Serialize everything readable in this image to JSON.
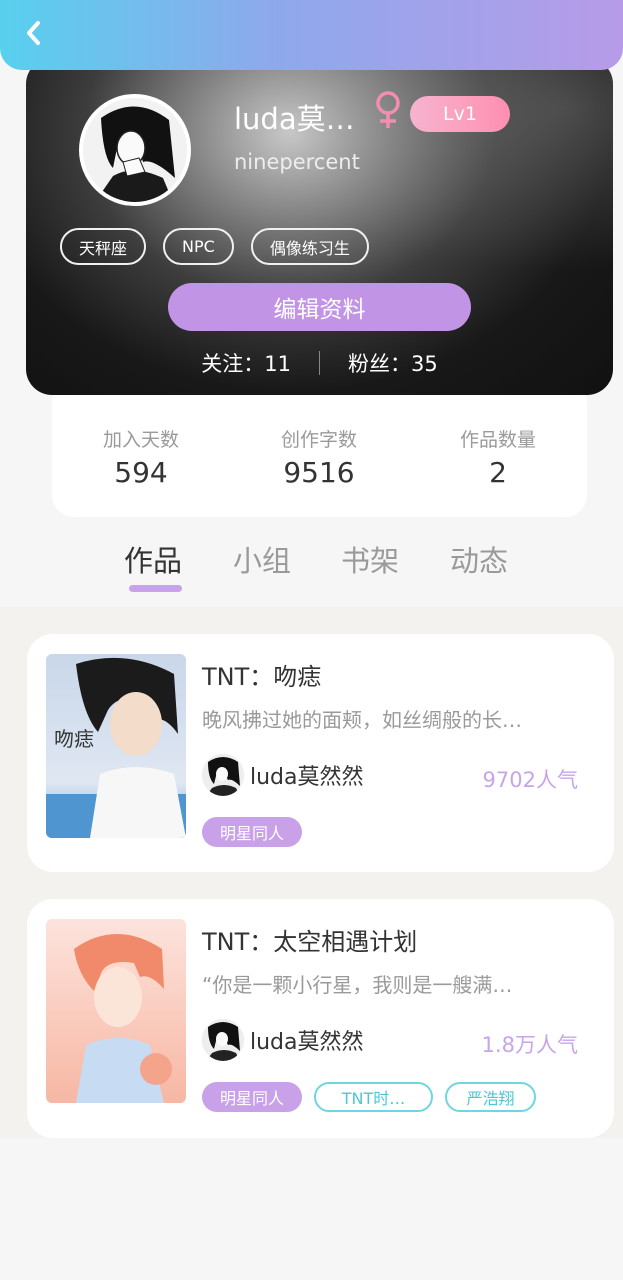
{
  "header": {
    "back_icon": "chevron-left-icon"
  },
  "profile": {
    "username": "luda莫…",
    "subname": "ninepercent",
    "gender_icon": "female-icon",
    "level": "Lv1",
    "tags": [
      "天秤座",
      "NPC",
      "偶像练习生"
    ],
    "edit_label": "编辑资料",
    "following_label": "关注：11",
    "followers_label": "粉丝：35"
  },
  "stats": [
    {
      "label": "加入天数",
      "value": "594"
    },
    {
      "label": "创作字数",
      "value": "9516"
    },
    {
      "label": "作品数量",
      "value": "2"
    }
  ],
  "tabs": [
    {
      "label": "作品",
      "active": true
    },
    {
      "label": "小组",
      "active": false
    },
    {
      "label": "书架",
      "active": false
    },
    {
      "label": "动态",
      "active": false
    }
  ],
  "works": [
    {
      "title": "TNT：吻痣",
      "desc": "晚风拂过她的面颊，如丝绸般的长…",
      "author": "luda莫然然",
      "popularity": "9702人气",
      "tags": [
        {
          "label": "明星同人",
          "style": "fill"
        }
      ],
      "cover_text": "吻痣"
    },
    {
      "title": "TNT：太空相遇计划",
      "desc": "“你是一颗小行星，我则是一艘满…",
      "author": "luda莫然然",
      "popularity": "1.8万人气",
      "tags": [
        {
          "label": "明星同人",
          "style": "fill"
        },
        {
          "label": "TNT时…",
          "style": "outline"
        },
        {
          "label": "严浩翔",
          "style": "outline"
        }
      ]
    }
  ],
  "colors": {
    "accent": "#c294e6",
    "header_start": "#58d0ee",
    "header_end": "#b79be8",
    "popularity": "#c8a4ea",
    "tag_outline": "#6fd6e0"
  }
}
